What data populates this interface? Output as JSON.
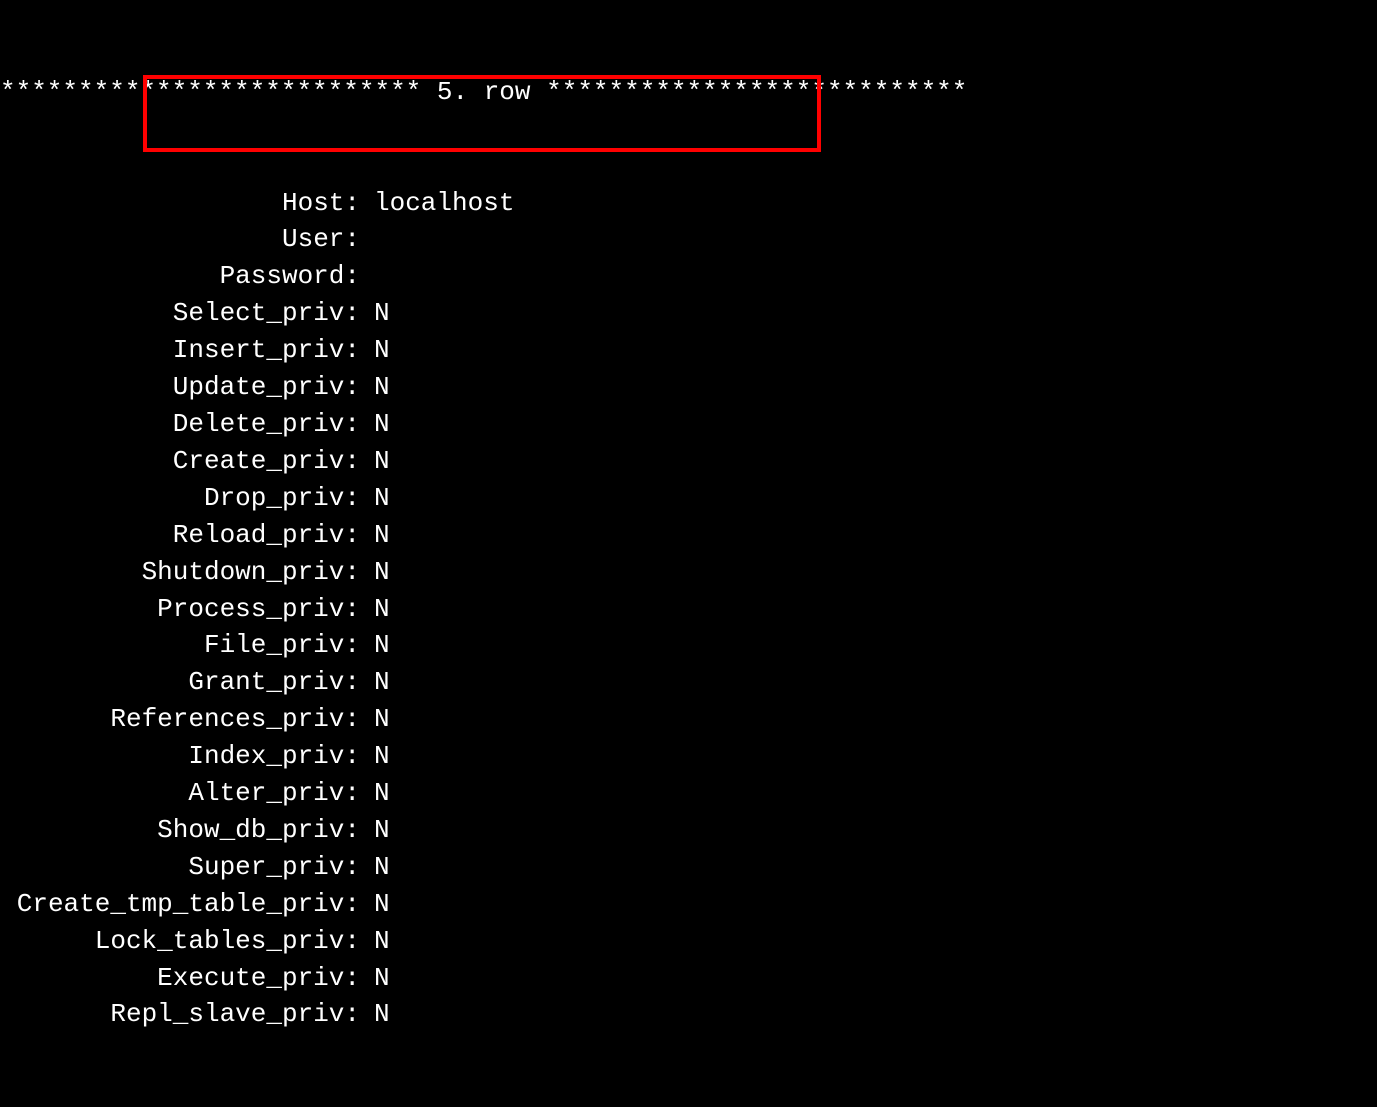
{
  "header": {
    "stars_left": "***************************",
    "row_label": " 5. row ",
    "stars_right": "***************************"
  },
  "fields": [
    {
      "label": "Host:",
      "value": "localhost"
    },
    {
      "label": "User:",
      "value": ""
    },
    {
      "label": "Password:",
      "value": ""
    },
    {
      "label": "Select_priv:",
      "value": "N"
    },
    {
      "label": "Insert_priv:",
      "value": "N"
    },
    {
      "label": "Update_priv:",
      "value": "N"
    },
    {
      "label": "Delete_priv:",
      "value": "N"
    },
    {
      "label": "Create_priv:",
      "value": "N"
    },
    {
      "label": "Drop_priv:",
      "value": "N"
    },
    {
      "label": "Reload_priv:",
      "value": "N"
    },
    {
      "label": "Shutdown_priv:",
      "value": "N"
    },
    {
      "label": "Process_priv:",
      "value": "N"
    },
    {
      "label": "File_priv:",
      "value": "N"
    },
    {
      "label": "Grant_priv:",
      "value": "N"
    },
    {
      "label": "References_priv:",
      "value": "N"
    },
    {
      "label": "Index_priv:",
      "value": "N"
    },
    {
      "label": "Alter_priv:",
      "value": "N"
    },
    {
      "label": "Show_db_priv:",
      "value": "N"
    },
    {
      "label": "Super_priv:",
      "value": "N"
    },
    {
      "label": "Create_tmp_table_priv:",
      "value": "N"
    },
    {
      "label": "Lock_tables_priv:",
      "value": "N"
    },
    {
      "label": "Execute_priv:",
      "value": "N"
    },
    {
      "label": "Repl_slave_priv:",
      "value": "N"
    }
  ],
  "highlight": {
    "color": "#ff0000"
  }
}
